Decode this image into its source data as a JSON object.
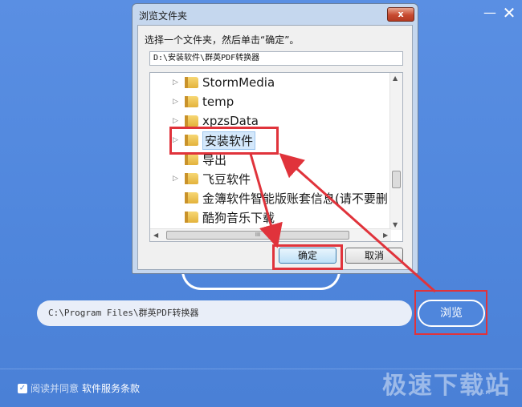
{
  "window": {
    "minimize_glyph": "—",
    "close_glyph": "✕"
  },
  "install": {
    "path_value": "C:\\Program Files\\群英PDF转换器",
    "browse_label": "浏览",
    "agree_text": "阅读并同意",
    "terms_link": "软件服务条款",
    "checked_glyph": "✓"
  },
  "watermark": {
    "text": "极速下载站",
    "sub": "…"
  },
  "dialog": {
    "title": "浏览文件夹",
    "close_glyph": "x",
    "prompt": "选择一个文件夹，然后单击“确定”。",
    "path": "D:\\安装软件\\群英PDF转换器",
    "ok_label": "确定",
    "cancel_label": "取消",
    "scroll_grip": "III",
    "tree": [
      {
        "label": "StormMedia",
        "expandable": true,
        "selected": false
      },
      {
        "label": "temp",
        "expandable": true,
        "selected": false
      },
      {
        "label": "xpzsData",
        "expandable": true,
        "selected": false
      },
      {
        "label": "安装软件",
        "expandable": true,
        "selected": true
      },
      {
        "label": "导出",
        "expandable": false,
        "selected": false
      },
      {
        "label": "飞豆软件",
        "expandable": true,
        "selected": false
      },
      {
        "label": "金簿软件智能版账套信息(请不要删",
        "expandable": false,
        "selected": false
      },
      {
        "label": "酷狗音乐下载",
        "expandable": false,
        "selected": false
      }
    ]
  },
  "colors": {
    "background": "#4f86dc",
    "highlight": "#e0333b",
    "selection": "#d4e8fb"
  }
}
